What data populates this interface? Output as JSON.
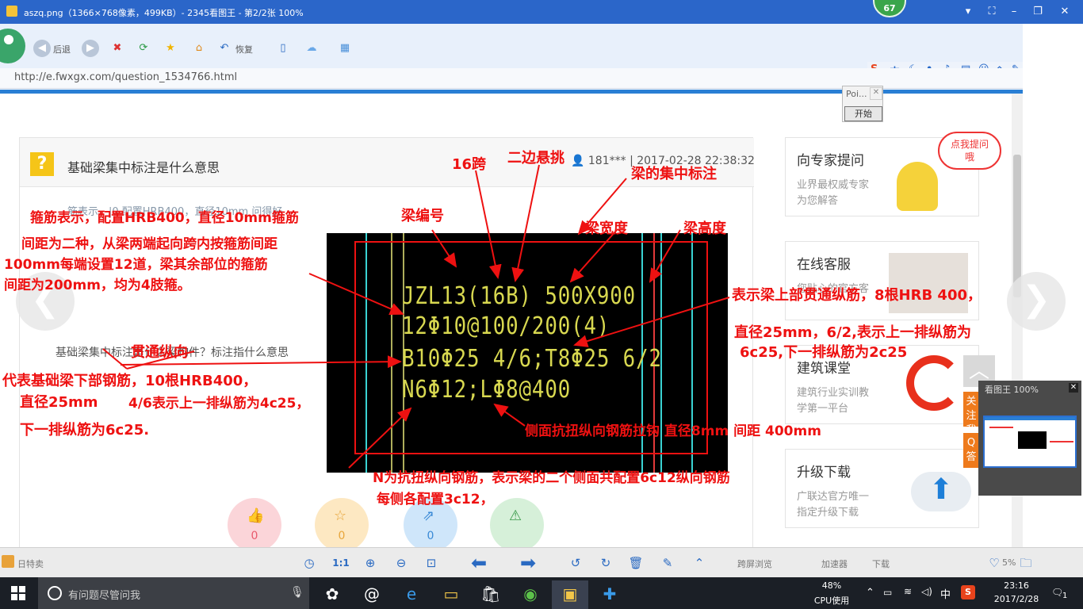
{
  "viewer": {
    "title": "aszq.png（1366×768像素，499KB）- 2345看图王 - 第2/2张 100%",
    "badge": "67",
    "toolbar": {
      "back_label": "后退",
      "restore_label": "恢复"
    },
    "bottom": {
      "ratio_label": "1:1",
      "left_faint": "日特卖",
      "r1": "跨屏浏览",
      "r2": "加速器",
      "r3": "下载",
      "zoom_mini": "5%"
    },
    "mini_title": "看图王 100%",
    "side_follow": "关注我们",
    "side_q": "Q答"
  },
  "browser": {
    "url": "http://e.fwxgx.com/question_1534766.html",
    "popup_title": "Poi...",
    "popup_start": "开始",
    "ime": {
      "sogou": "S",
      "zh": "中"
    }
  },
  "page": {
    "question_title": "基础梁集中标注是什么意思",
    "question_meta": "181*** | 2017-02-28 22:38:32",
    "faint_row1": "筋表示，|0 配置HRB400，直径10mm 问得好",
    "faint_row2": "基础梁集中标注是什么梁构件？标注指什么意思",
    "circles": [
      {
        "count": "0"
      },
      {
        "count": "0"
      },
      {
        "count": "0"
      },
      {
        "count": ""
      }
    ],
    "sidebar": [
      {
        "title": "向专家提问",
        "sub1": "业界最权威专家",
        "sub2": "为您解答",
        "bubble": "点我提问哦"
      },
      {
        "title": "在线客服",
        "sub1": "您贴心的官方客",
        "sub2": ""
      },
      {
        "title": "建筑课堂",
        "sub1": "建筑行业实训教",
        "sub2": "学第一平台"
      },
      {
        "title": "升级下载",
        "sub1": "广联达官方唯一",
        "sub2": "指定升级下载"
      }
    ]
  },
  "drawing": {
    "line1": "JZL13(16B) 500X900",
    "line2": "12Φ10@100/200(4)",
    "line3": "B10Φ25 4/6;T8Φ25 6/2",
    "line4": "N6Φ12;LΦ8@400"
  },
  "annotations": {
    "span16": "16跨",
    "cantilever": "二边悬挑",
    "concentrated": "梁的集中标注",
    "beam_no": "梁编号",
    "beam_width": "梁宽度",
    "beam_height": "梁高度",
    "stirrup1": "箍筋表示，配置HRB400，直径10mm箍筋",
    "stirrup2": "间距为二种，从梁两端起向跨内按箍筋间距",
    "stirrup3": "100mm每端设置12道，梁其余部位的箍筋",
    "stirrup4": "间距为200mm，均为4肢箍。",
    "top1": "表示梁上部贯通纵筋，8根HRB 400，",
    "top2": "直径25mm，6/2,表示上一排纵筋为",
    "top3": "6c25,下一排纵筋为2c25",
    "through": "贯通纵向",
    "bottom1": "代表基础梁下部钢筋，10根HRB400，",
    "bottom2": "直径25mm",
    "bottom3": "4/6表示上一排纵筋为4c25，",
    "bottom4": "下一排纵筋为6c25.",
    "side_tie": "侧面抗扭纵向钢筋拉钩 直径8mm  间距  400mm",
    "n1": "N为抗扭纵向钢筋，表示梁的二个侧面共配置6c12纵向钢筋",
    "n2": "每侧各配置3c12，"
  },
  "taskbar": {
    "search_placeholder": "有问题尽管问我",
    "cpu_pct": "48%",
    "cpu_label": "CPU使用",
    "ime": "中",
    "time": "23:16",
    "date": "2017/2/28",
    "notif": "1"
  }
}
